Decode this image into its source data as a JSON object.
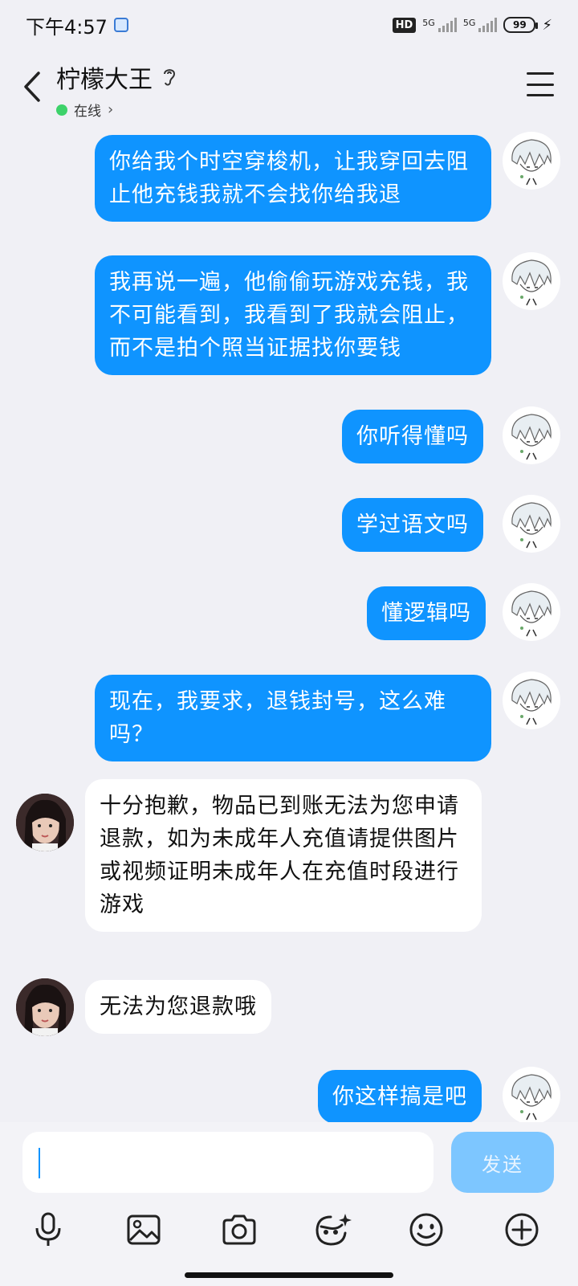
{
  "status_bar": {
    "time": "下午4:57",
    "network1": "5G",
    "network2": "5G",
    "hd_label": "HD",
    "battery": "99"
  },
  "header": {
    "contact_name": "柠檬大王",
    "status": "在线"
  },
  "messages": [
    {
      "side": "out",
      "text": "你给我个时空穿梭机，让我穿回去阻止他充钱我就不会找你给我退"
    },
    {
      "side": "out",
      "text": "我再说一遍，他偷偷玩游戏充钱，我不可能看到，我看到了我就会阻止，而不是拍个照当证据找你要钱"
    },
    {
      "side": "out",
      "text": "你听得懂吗"
    },
    {
      "side": "out",
      "text": "学过语文吗"
    },
    {
      "side": "out",
      "text": "懂逻辑吗"
    },
    {
      "side": "out",
      "text": "现在，我要求，退钱封号，这么难吗？"
    },
    {
      "side": "in",
      "text": "十分抱歉，物品已到账无法为您申请退款，如为未成年人充值请提供图片或视频证明未成年人在充值时段进行游戏"
    },
    {
      "side": "in",
      "text": "无法为您退款哦"
    },
    {
      "side": "out",
      "text": "你这样搞是吧"
    }
  ],
  "input": {
    "value": "",
    "send_label": "发送"
  },
  "toolbar": {
    "icons": [
      "microphone-icon",
      "image-icon",
      "camera-icon",
      "sticker-icon",
      "emoji-icon",
      "plus-icon"
    ]
  },
  "colors": {
    "outgoing_bubble": "#0f94ff",
    "incoming_bubble": "#ffffff",
    "background": "#f0f0f5",
    "send_button": "#7dc6ff",
    "online": "#3dd26a"
  }
}
